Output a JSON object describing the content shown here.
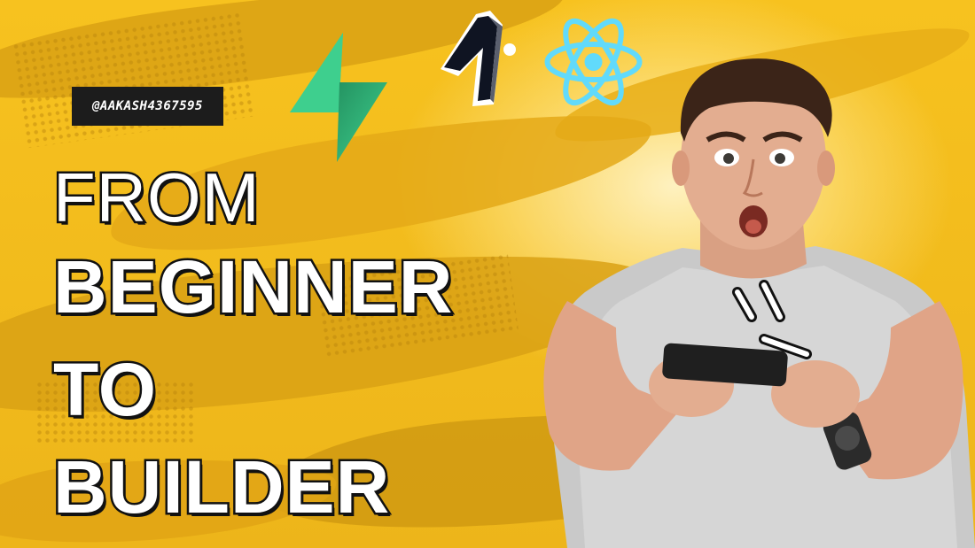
{
  "thumbnail": {
    "handle": "@AAKASH4367595",
    "title_lines": [
      "FROM",
      "BEGINNER",
      "TO",
      "BUILDER"
    ],
    "logos": [
      "supabase-logo",
      "lovable-logo",
      "react-logo"
    ],
    "colors": {
      "background": "#F2BB1C",
      "title_fill": "#FFFFFF",
      "title_outline": "#111111",
      "handle_bg": "#1C1C1C",
      "supabase_green": "#3ECF8E",
      "react_blue": "#61DAFB"
    }
  }
}
